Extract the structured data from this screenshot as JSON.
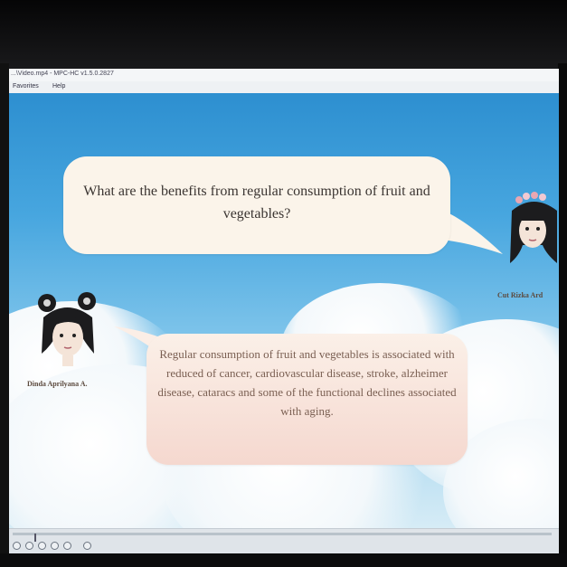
{
  "window": {
    "title": "...\\Video.mp4 - MPC-HC v1.5.0.2827",
    "menu": [
      "Favorites",
      "Help"
    ]
  },
  "dialogue": {
    "question": "What are the benefits from regular consumption of fruit and vegetables?",
    "answer": "Regular consumption of fruit and vegetables is associated with reduced of cancer, cardiovascular disease, stroke, alzheimer disease, cataracs and some of the functional declines associated with aging.",
    "speaker_right": "Cut Rizka Ard",
    "speaker_left": "Dinda Aprilyana A."
  },
  "colors": {
    "sky_top": "#2d8fd0",
    "bubble_question": "#fbf4ea",
    "bubble_answer": "#f5d8cf",
    "text_dark": "#3b3532"
  },
  "player": {
    "seek_fraction": 0.04,
    "buttons": [
      "stop-icon",
      "play-icon",
      "pause-icon",
      "prev-icon",
      "next-icon",
      "volume-icon"
    ]
  }
}
